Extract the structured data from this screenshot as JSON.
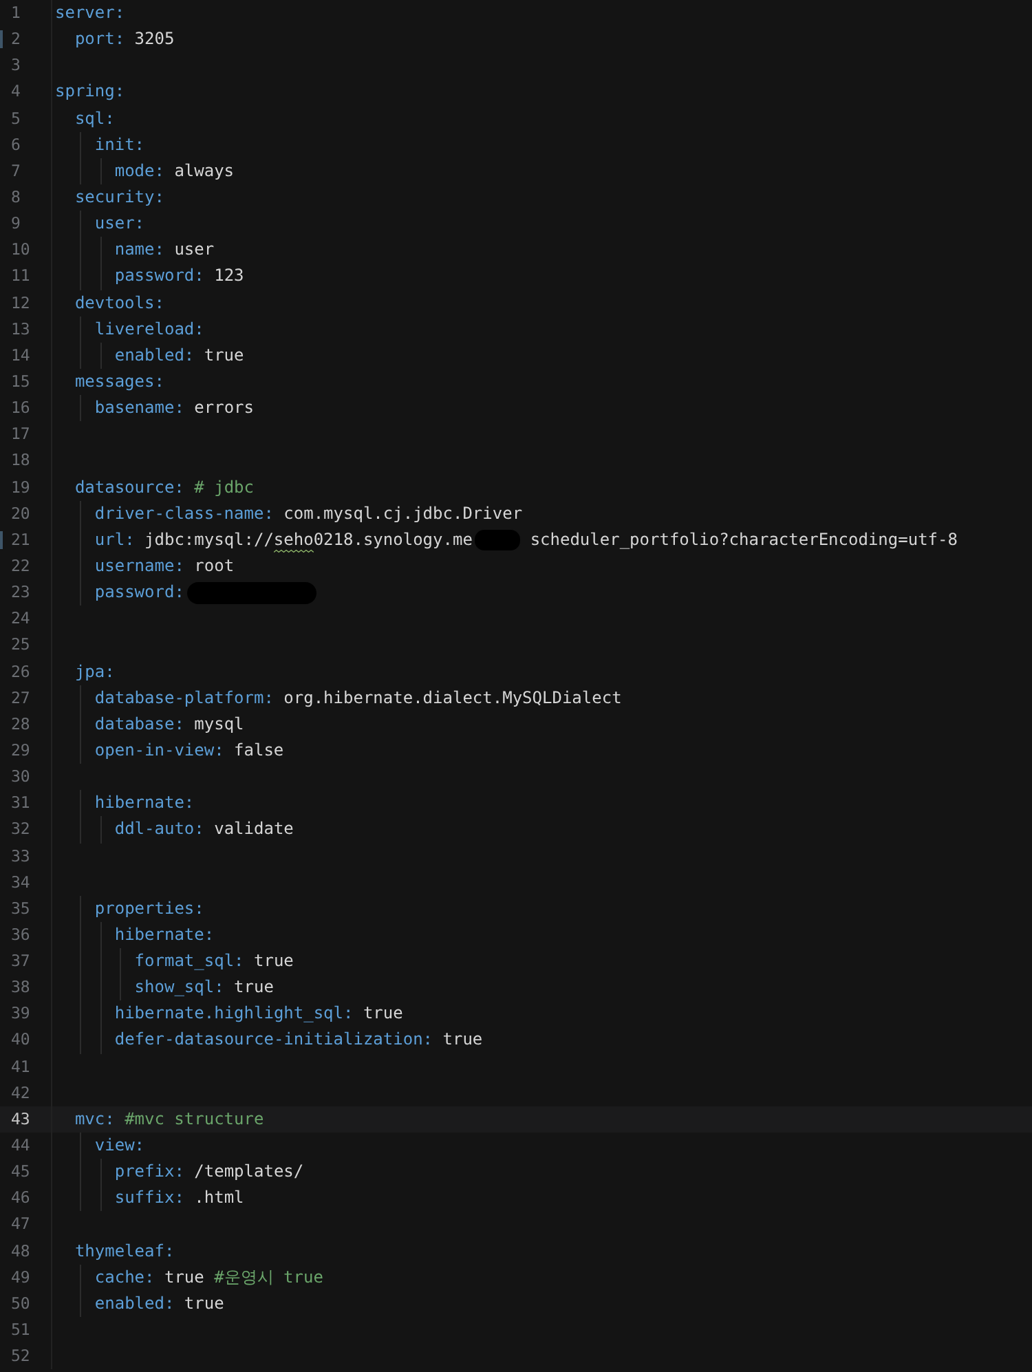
{
  "editor": {
    "lines": [
      {
        "n": "1",
        "key": "server:",
        "children": [
          {
            "n": "2",
            "key": "port:",
            "value": "3205",
            "changed": true
          }
        ]
      },
      {
        "n": "3"
      },
      {
        "n": "4",
        "key": "spring:",
        "children": [
          {
            "n": "5",
            "key": "sql:",
            "children": [
              {
                "n": "6",
                "key": "init:",
                "children": [
                  {
                    "n": "7",
                    "key": "mode:",
                    "value": "always"
                  }
                ]
              }
            ]
          },
          {
            "n": "8",
            "key": "security:",
            "children": [
              {
                "n": "9",
                "key": "user:",
                "children": [
                  {
                    "n": "10",
                    "key": "name:",
                    "value": "user"
                  },
                  {
                    "n": "11",
                    "key": "password:",
                    "value": "123"
                  }
                ]
              }
            ]
          },
          {
            "n": "12",
            "key": "devtools:",
            "children": [
              {
                "n": "13",
                "key": "livereload:",
                "children": [
                  {
                    "n": "14",
                    "key": "enabled:",
                    "value": "true"
                  }
                ]
              }
            ]
          },
          {
            "n": "15",
            "key": "messages:",
            "children": [
              {
                "n": "16",
                "key": "basename:",
                "value": "errors"
              }
            ]
          },
          {
            "n": "17"
          },
          {
            "n": "18"
          },
          {
            "n": "19",
            "key": "datasource:",
            "comment": "# jdbc",
            "children": [
              {
                "n": "20",
                "key": "driver-class-name:",
                "value": "com.mysql.cj.jdbc.Driver"
              },
              {
                "n": "21",
                "key": "url:",
                "value": "jdbc:mysql://seho0218.synology.me",
                "redacted": true,
                "value_after": "scheduler_portfolio?characterEncoding=utf-8",
                "spellcheck": true,
                "changed": true
              },
              {
                "n": "22",
                "key": "username:",
                "value": "root"
              },
              {
                "n": "23",
                "key": "password:",
                "redacted": true
              }
            ]
          },
          {
            "n": "24"
          },
          {
            "n": "25"
          },
          {
            "n": "26",
            "key": "jpa:",
            "children": [
              {
                "n": "27",
                "key": "database-platform:",
                "value": "org.hibernate.dialect.MySQLDialect"
              },
              {
                "n": "28",
                "key": "database:",
                "value": "mysql"
              },
              {
                "n": "29",
                "key": "open-in-view:",
                "value": "false"
              },
              {
                "n": "30"
              },
              {
                "n": "31",
                "key": "hibernate:",
                "children": [
                  {
                    "n": "32",
                    "key": "ddl-auto:",
                    "value": "validate"
                  }
                ]
              },
              {
                "n": "33"
              },
              {
                "n": "34"
              },
              {
                "n": "35",
                "key": "properties:",
                "children": [
                  {
                    "n": "36",
                    "key": "hibernate:",
                    "children": [
                      {
                        "n": "37",
                        "key": "format_sql:",
                        "value": "true"
                      },
                      {
                        "n": "38",
                        "key": "show_sql:",
                        "value": "true"
                      }
                    ]
                  },
                  {
                    "n": "39",
                    "key": "hibernate.highlight_sql:",
                    "value": "true"
                  },
                  {
                    "n": "40",
                    "key": "defer-datasource-initialization:",
                    "value": "true"
                  }
                ]
              }
            ]
          },
          {
            "n": "41"
          },
          {
            "n": "42"
          },
          {
            "n": "43",
            "key": "mvc:",
            "comment": "#mvc structure",
            "current": true,
            "children": [
              {
                "n": "44",
                "key": "view:",
                "children": [
                  {
                    "n": "45",
                    "key": "prefix:",
                    "value": "/templates/"
                  },
                  {
                    "n": "46",
                    "key": "suffix:",
                    "value": ".html"
                  }
                ]
              }
            ]
          },
          {
            "n": "47"
          },
          {
            "n": "48",
            "key": "thymeleaf:",
            "children": [
              {
                "n": "49",
                "key": "cache:",
                "value": "true",
                "comment": "#운영시 true"
              },
              {
                "n": "50",
                "key": "enabled:",
                "value": "true"
              }
            ]
          },
          {
            "n": "51"
          },
          {
            "n": "52"
          }
        ]
      }
    ]
  }
}
